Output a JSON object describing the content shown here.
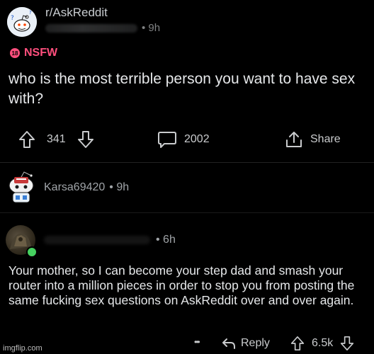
{
  "post": {
    "subreddit": "r/AskReddit",
    "age": "• 9h",
    "nsfw_label": "NSFW",
    "nsfw_badge": "18",
    "title": "who is the most terrible person you want to have sex with?",
    "upvotes": "341",
    "comments": "2002",
    "share_label": "Share"
  },
  "comment1": {
    "username": "Karsa69420",
    "age": "• 9h"
  },
  "comment2": {
    "age": "• 6h",
    "body": "Your mother, so I can become your step dad and smash your router into a million pieces in order to stop you from posting the same fucking sex questions on AskReddit over and over again.",
    "more_label": "•••",
    "reply_label": "Reply",
    "score": "6.5k"
  },
  "watermark": "imgflip.com",
  "colors": {
    "background": "#000000",
    "nsfw": "#ff4f7d",
    "online": "#46d160"
  },
  "icons": [
    "snoo-avatar-icon",
    "upvote-icon",
    "downvote-icon",
    "comment-icon",
    "share-icon",
    "reply-icon"
  ]
}
